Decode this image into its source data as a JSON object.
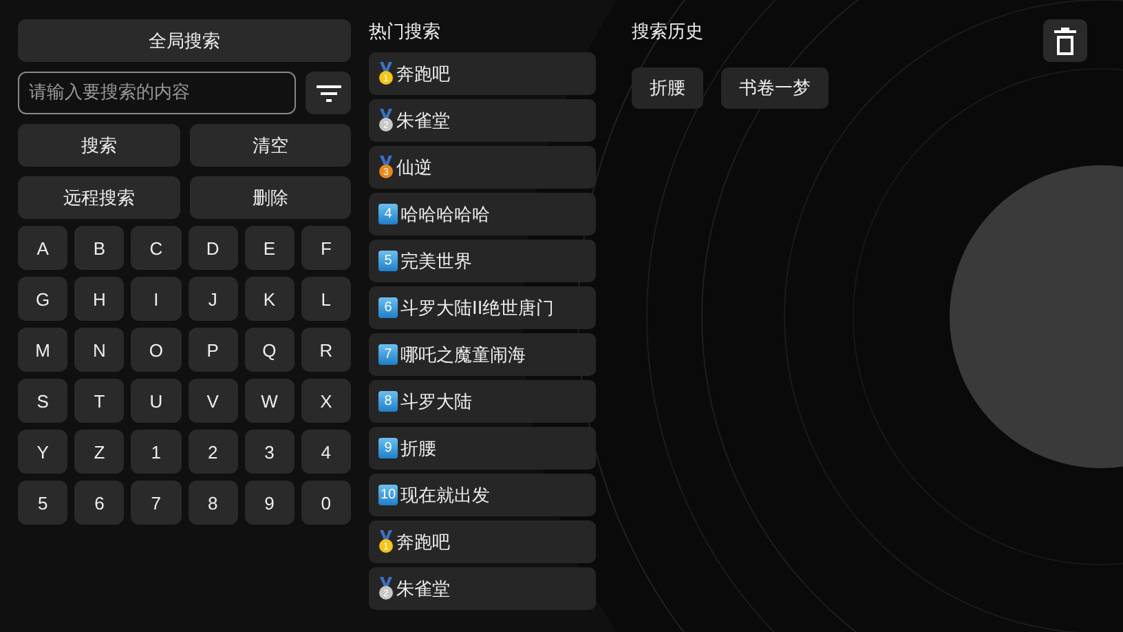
{
  "global_search_button": "全局搜索",
  "search_field": {
    "placeholder": "请输入要搜索的内容"
  },
  "action_buttons": [
    "搜索",
    "清空",
    "远程搜索",
    "删除"
  ],
  "keys": [
    "A",
    "B",
    "C",
    "D",
    "E",
    "F",
    "G",
    "H",
    "I",
    "J",
    "K",
    "L",
    "M",
    "N",
    "O",
    "P",
    "Q",
    "R",
    "S",
    "T",
    "U",
    "V",
    "W",
    "X",
    "Y",
    "Z",
    "1",
    "2",
    "3",
    "4",
    "5",
    "6",
    "7",
    "8",
    "9",
    "0"
  ],
  "hot_search": {
    "title": "热门搜索",
    "items": [
      {
        "kind": "medal",
        "rank": "1",
        "color": "#f5c518",
        "label": "奔跑吧"
      },
      {
        "kind": "medal",
        "rank": "2",
        "color": "#c8c8c8",
        "label": "朱雀堂"
      },
      {
        "kind": "medal",
        "rank": "3",
        "color": "#e8871e",
        "label": "仙逆"
      },
      {
        "kind": "keycap",
        "rank": "4",
        "label": "哈哈哈哈哈"
      },
      {
        "kind": "keycap",
        "rank": "5",
        "label": "完美世界"
      },
      {
        "kind": "keycap",
        "rank": "6",
        "label": "斗罗大陆II绝世唐门"
      },
      {
        "kind": "keycap",
        "rank": "7",
        "label": "哪吒之魔童闹海"
      },
      {
        "kind": "keycap",
        "rank": "8",
        "label": "斗罗大陆"
      },
      {
        "kind": "keycap",
        "rank": "9",
        "label": "折腰"
      },
      {
        "kind": "keycap",
        "rank": "10",
        "label": "现在就出发"
      },
      {
        "kind": "medal",
        "rank": "1",
        "color": "#f5c518",
        "label": "奔跑吧"
      },
      {
        "kind": "medal",
        "rank": "2",
        "color": "#c8c8c8",
        "label": "朱雀堂"
      }
    ]
  },
  "history": {
    "title": "搜索历史",
    "items": [
      "折腰",
      "书卷一梦"
    ]
  }
}
